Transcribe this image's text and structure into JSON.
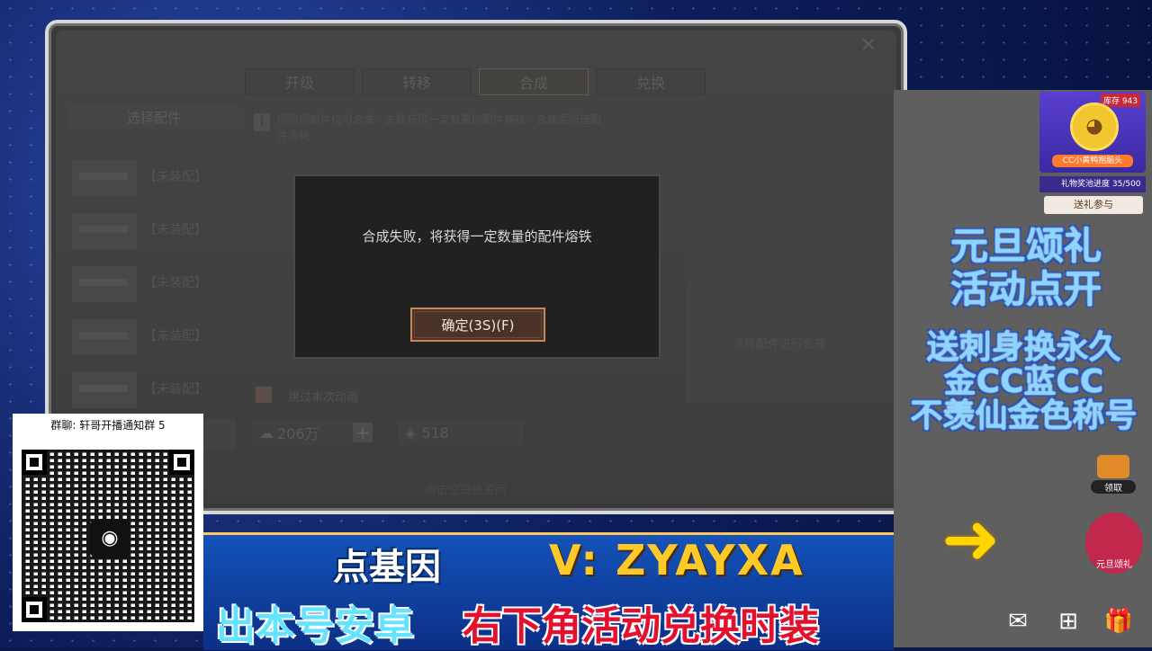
{
  "game": {
    "tabs": [
      "开级",
      "转移",
      "合成",
      "兑换"
    ],
    "active_tab": "合成",
    "select_parts_header": "选择配件",
    "parts": [
      {
        "label": "【未装配】"
      },
      {
        "label": "【未装配】"
      },
      {
        "label": "【未装配】"
      },
      {
        "label": "【未装配】"
      },
      {
        "label": "【未装配】"
      }
    ],
    "info_text": "同阶同部件位可合成，失败获得一定数量的配件熔铁，合成后所选配件消耗",
    "skip_animation_label": "跳过本次动画",
    "resource1": "206万",
    "resource2": "518",
    "select_hint": "选择配件进行合成",
    "bottom_hint": "点击空白处关闭",
    "close_symbol": "✕"
  },
  "modal": {
    "message": "合成失败，将获得一定数量的配件熔铁",
    "confirm_label": "确定(3S)(F)"
  },
  "sidebar": {
    "stock_badge": "库存 943",
    "gift_name": "CC小黄鸭抱脑头",
    "progress_text": "礼物奖池进度 35/500",
    "join_button": "送礼参与",
    "promo_line1": "元旦颂礼",
    "promo_line2": "活动点开",
    "promo_line3": "送刺身换永久",
    "promo_line4": "金CC蓝CC",
    "promo_line5": "不羡仙金色称号",
    "claim_label": "领取",
    "event_label": "元旦颂礼"
  },
  "qr": {
    "title": "群聊: 轩哥开播通知群 5"
  },
  "banner": {
    "brand": "点基因",
    "vid": "V: ZYAYXA",
    "slogan_a": "出本号安卓",
    "slogan_b": "右下角活动兑换时装"
  },
  "colors": {
    "modal_bg": "#222121",
    "confirm_border": "#c4895a",
    "promo_text": "#8ad6ff",
    "slogan_red": "#e3102e",
    "vid_yellow": "#ffc928"
  }
}
